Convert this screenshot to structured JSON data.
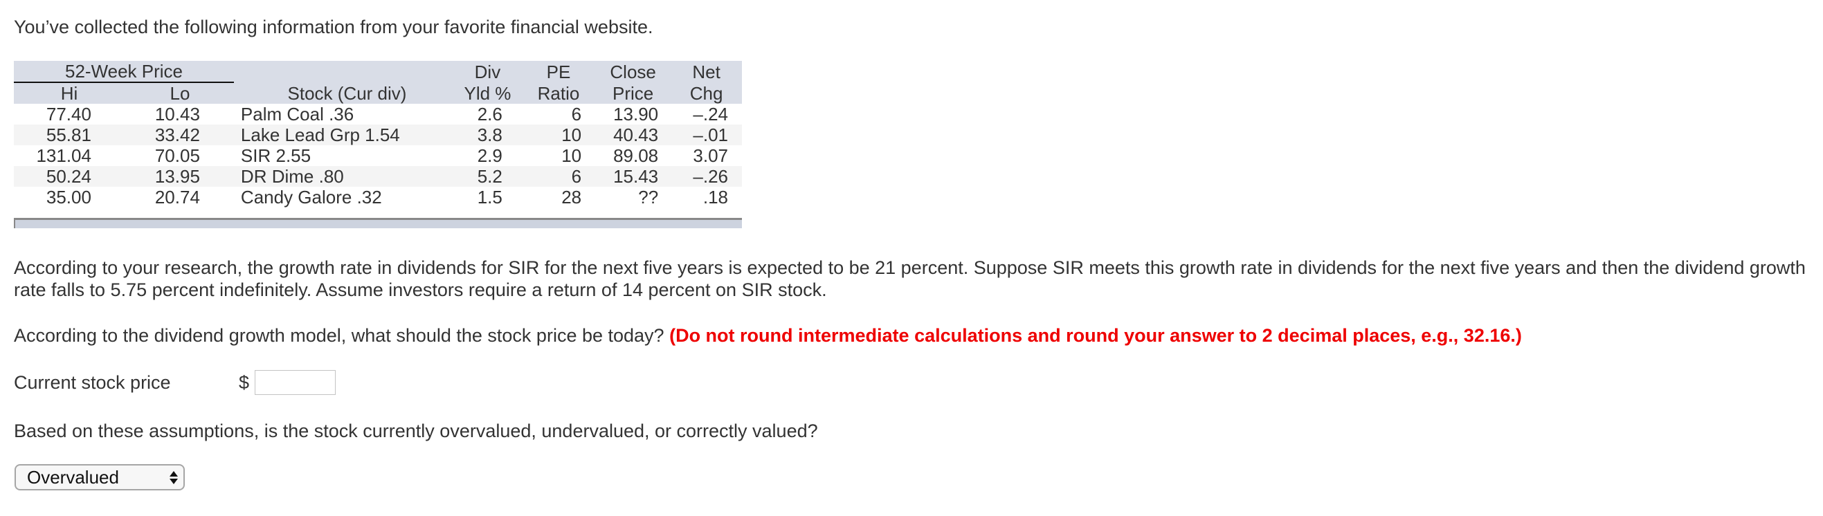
{
  "intro": "You’ve collected the following information from your favorite financial website.",
  "table": {
    "group_header": "52-Week Price",
    "headers": {
      "hi": "Hi",
      "lo": "Lo",
      "stock": "Stock (Cur div)",
      "div_line1": "Div",
      "div_line2": "Yld %",
      "pe_line1": "PE",
      "pe_line2": "Ratio",
      "close_line1": "Close",
      "close_line2": "Price",
      "chg_line1": "Net",
      "chg_line2": "Chg"
    },
    "rows": [
      {
        "hi": "77.40",
        "lo": "10.43",
        "stock": "Palm Coal .36",
        "div_yld": "2.6",
        "pe": "6",
        "close": "13.90",
        "net_chg": "–.24"
      },
      {
        "hi": "55.81",
        "lo": "33.42",
        "stock": "Lake Lead Grp 1.54",
        "div_yld": "3.8",
        "pe": "10",
        "close": "40.43",
        "net_chg": "–.01"
      },
      {
        "hi": "131.04",
        "lo": "70.05",
        "stock": "SIR 2.55",
        "div_yld": "2.9",
        "pe": "10",
        "close": "89.08",
        "net_chg": "3.07"
      },
      {
        "hi": "50.24",
        "lo": "13.95",
        "stock": "DR Dime .80",
        "div_yld": "5.2",
        "pe": "6",
        "close": "15.43",
        "net_chg": "–.26"
      },
      {
        "hi": "35.00",
        "lo": "20.74",
        "stock": "Candy Galore .32",
        "div_yld": "1.5",
        "pe": "28",
        "close": "??",
        "net_chg": ".18"
      }
    ]
  },
  "paragraph1": "According to your research, the growth rate in dividends for SIR for the next five years is expected to be 21 percent. Suppose SIR meets this growth rate in dividends for the next five years and then the dividend growth rate falls to 5.75 percent indefinitely. Assume investors require a return of 14 percent on SIR stock.",
  "question1": {
    "text": "According to the dividend growth model, what should the stock price be today?",
    "instruction": "(Do not round intermediate calculations and round your answer to 2 decimal places, e.g., 32.16.)",
    "instruction_color": "#ee0000"
  },
  "answer": {
    "label": "Current stock price",
    "currency": "$",
    "value": "",
    "placeholder": ""
  },
  "question2": "Based on these assumptions, is the stock currently overvalued, undervalued, or correctly valued?",
  "valuation_select": {
    "selected": "Overvalued"
  }
}
